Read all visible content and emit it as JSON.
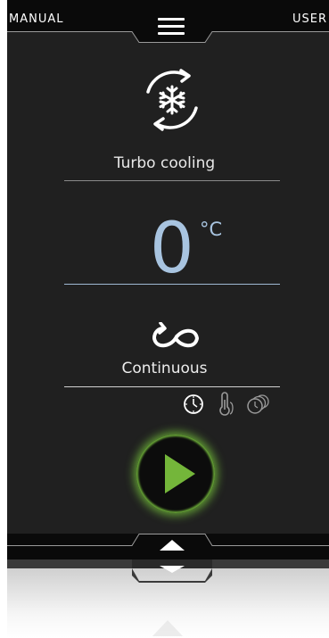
{
  "header": {
    "left_label": "MANUAL",
    "right_label": "USER",
    "menu_icon": "hamburger-icon"
  },
  "mode": {
    "icon": "turbo-cooling-snowflake-cycle-icon",
    "label": "Turbo cooling"
  },
  "temperature": {
    "value": "0",
    "unit": "°C"
  },
  "cycle": {
    "icon": "infinity-loop-icon",
    "label": "Continuous"
  },
  "options": [
    {
      "icon": "clock-icon",
      "active": true
    },
    {
      "icon": "thermometer-probe-icon",
      "active": false
    },
    {
      "icon": "multi-timer-icon",
      "active": false
    }
  ],
  "start": {
    "icon": "play-icon",
    "color": "#74b63a"
  },
  "footer": {
    "icon": "chevron-up-icon"
  },
  "colors": {
    "background": "#202020",
    "accent_blue": "#a8c4e0",
    "glow_green": "#7cc83c"
  }
}
